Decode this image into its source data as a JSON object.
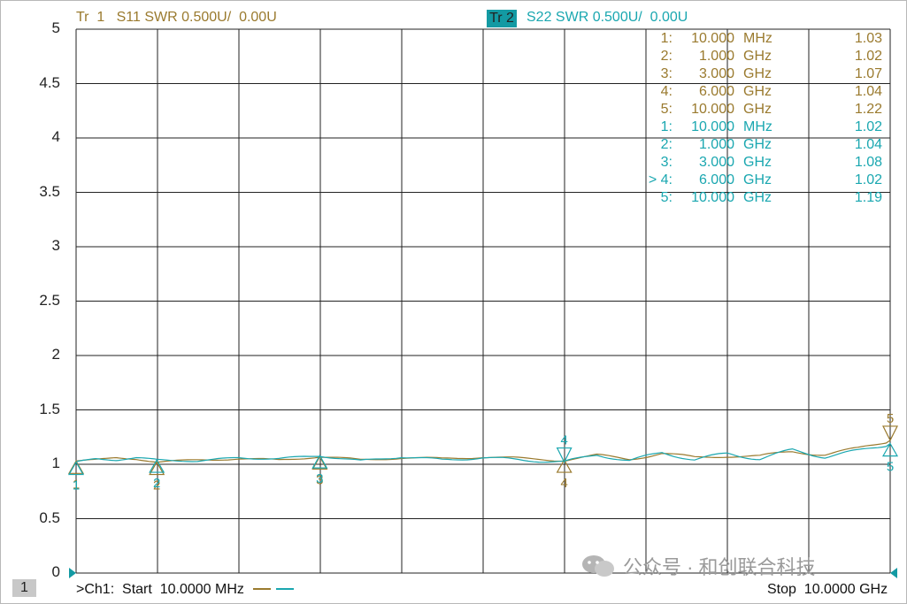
{
  "header": {
    "trace1": "Tr  1   S11 SWR 0.500U/  0.00U",
    "trace2_badge": "Tr  2",
    "trace2": "S22 SWR 0.500U/  0.00U"
  },
  "footer": {
    "channel_number": "1",
    "start": ">Ch1:  Start  10.0000 MHz",
    "stop": "Stop  10.0000 GHz"
  },
  "watermark": "公众号 · 和创联合科技",
  "colors": {
    "trace1": "#9a7a2e",
    "trace2": "#1aa7b0",
    "grid": "#222222",
    "reference": "#139aa3"
  },
  "markers": [
    {
      "trace": 1,
      "idx": "1:",
      "freq": "10.000",
      "unit": "MHz",
      "value": "1.03"
    },
    {
      "trace": 1,
      "idx": "2:",
      "freq": "1.000",
      "unit": "GHz",
      "value": "1.02"
    },
    {
      "trace": 1,
      "idx": "3:",
      "freq": "3.000",
      "unit": "GHz",
      "value": "1.07"
    },
    {
      "trace": 1,
      "idx": "4:",
      "freq": "6.000",
      "unit": "GHz",
      "value": "1.04"
    },
    {
      "trace": 1,
      "idx": "5:",
      "freq": "10.000",
      "unit": "GHz",
      "value": "1.22"
    },
    {
      "trace": 2,
      "idx": "1:",
      "freq": "10.000",
      "unit": "MHz",
      "value": "1.02"
    },
    {
      "trace": 2,
      "idx": "2:",
      "freq": "1.000",
      "unit": "GHz",
      "value": "1.04"
    },
    {
      "trace": 2,
      "idx": "3:",
      "freq": "3.000",
      "unit": "GHz",
      "value": "1.08"
    },
    {
      "trace": 2,
      "idx": "> 4:",
      "freq": "6.000",
      "unit": "GHz",
      "value": "1.02"
    },
    {
      "trace": 2,
      "idx": "5:",
      "freq": "10.000",
      "unit": "GHz",
      "value": "1.19"
    }
  ],
  "chart_data": {
    "type": "line",
    "ylabel": "",
    "xlabel": "",
    "ylim": [
      0,
      5
    ],
    "xlim": [
      0.01,
      10
    ],
    "yticks": [
      "5",
      "4.5",
      "4",
      "3.5",
      "3",
      "2.5",
      "2",
      "1.5",
      "1",
      "0.5",
      "0"
    ],
    "grid": true,
    "reference_value": 1.0,
    "series": [
      {
        "name": "S11 SWR",
        "x": [
          0.01,
          0.25,
          0.5,
          0.75,
          1.0,
          1.5,
          2.0,
          2.5,
          3.0,
          3.5,
          4.0,
          4.5,
          5.0,
          5.5,
          6.0,
          6.4,
          6.8,
          7.2,
          7.6,
          8.0,
          8.4,
          8.8,
          9.2,
          9.6,
          10.0
        ],
        "y": [
          1.03,
          1.04,
          1.06,
          1.05,
          1.02,
          1.04,
          1.05,
          1.04,
          1.07,
          1.04,
          1.06,
          1.05,
          1.07,
          1.05,
          1.04,
          1.08,
          1.05,
          1.1,
          1.06,
          1.08,
          1.07,
          1.12,
          1.09,
          1.14,
          1.22
        ]
      },
      {
        "name": "S22 SWR",
        "x": [
          0.01,
          0.25,
          0.5,
          0.75,
          1.0,
          1.5,
          2.0,
          2.5,
          3.0,
          3.5,
          4.0,
          4.5,
          5.0,
          5.5,
          6.0,
          6.4,
          6.8,
          7.2,
          7.6,
          8.0,
          8.4,
          8.8,
          9.2,
          9.6,
          10.0
        ],
        "y": [
          1.02,
          1.05,
          1.04,
          1.06,
          1.04,
          1.03,
          1.06,
          1.05,
          1.08,
          1.03,
          1.07,
          1.04,
          1.06,
          1.04,
          1.02,
          1.09,
          1.03,
          1.11,
          1.04,
          1.1,
          1.05,
          1.13,
          1.07,
          1.12,
          1.19
        ]
      }
    ],
    "marker_points": [
      {
        "trace": 1,
        "label": "1",
        "x": 0.01,
        "y": 1.03
      },
      {
        "trace": 1,
        "label": "2",
        "x": 1.0,
        "y": 1.02
      },
      {
        "trace": 1,
        "label": "3",
        "x": 3.0,
        "y": 1.07
      },
      {
        "trace": 1,
        "label": "4",
        "x": 6.0,
        "y": 1.04
      },
      {
        "trace": 1,
        "label": "5",
        "x": 10.0,
        "y": 1.22
      },
      {
        "trace": 2,
        "label": "1",
        "x": 0.01,
        "y": 1.02
      },
      {
        "trace": 2,
        "label": "2",
        "x": 1.0,
        "y": 1.04
      },
      {
        "trace": 2,
        "label": "3",
        "x": 3.0,
        "y": 1.08
      },
      {
        "trace": 2,
        "label": "4",
        "x": 6.0,
        "y": 1.02
      },
      {
        "trace": 2,
        "label": "5",
        "x": 10.0,
        "y": 1.19
      }
    ]
  }
}
